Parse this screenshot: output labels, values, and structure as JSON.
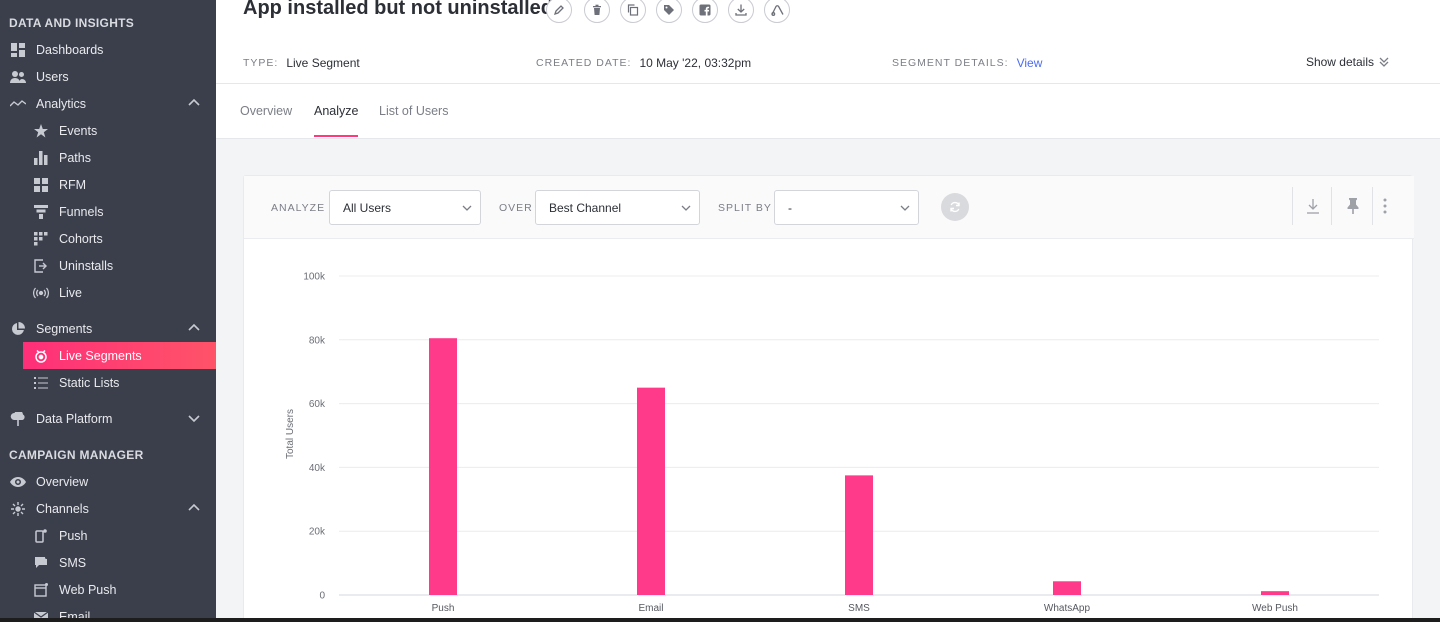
{
  "sidebar": {
    "sections": {
      "data": "DATA AND INSIGHTS",
      "campaign": "CAMPAIGN MANAGER"
    },
    "items": {
      "dashboards": "Dashboards",
      "users": "Users",
      "analytics": "Analytics",
      "events": "Events",
      "paths": "Paths",
      "rfm": "RFM",
      "funnels": "Funnels",
      "cohorts": "Cohorts",
      "uninstalls": "Uninstalls",
      "live": "Live",
      "segments": "Segments",
      "live_segments": "Live Segments",
      "static_lists": "Static Lists",
      "data_platform": "Data Platform",
      "overview": "Overview",
      "channels": "Channels",
      "push": "Push",
      "sms": "SMS",
      "web_push": "Web Push",
      "email": "Email"
    }
  },
  "header": {
    "title": "App installed but not uninstalled",
    "type_label": "TYPE:",
    "type_value": "Live Segment",
    "created_label": "CREATED DATE:",
    "created_value": "10 May '22, 03:32pm",
    "details_label": "SEGMENT DETAILS:",
    "details_link": "View",
    "show_details": "Show details"
  },
  "tabs": [
    "Overview",
    "Analyze",
    "List of Users"
  ],
  "toolbar": {
    "analyze_label": "ANALYZE",
    "analyze_value": "All Users",
    "over_label": "OVER",
    "over_value": "Best Channel",
    "split_label": "SPLIT BY",
    "split_value": "-"
  },
  "colors": {
    "accent": "#ff3a7a",
    "bar": "#ff3a8a",
    "sidebar": "#3b3f4b",
    "link": "#4a6cf7"
  },
  "chart_data": {
    "type": "bar",
    "categories": [
      "Push",
      "Email",
      "SMS",
      "WhatsApp",
      "Web Push"
    ],
    "values": [
      80500,
      65000,
      37500,
      4300,
      1200
    ],
    "ylabel": "Total Users",
    "xlabel": "",
    "ylim": [
      0,
      100000
    ],
    "yticks": [
      "0",
      "20k",
      "40k",
      "60k",
      "80k",
      "100k"
    ],
    "grid": true
  }
}
